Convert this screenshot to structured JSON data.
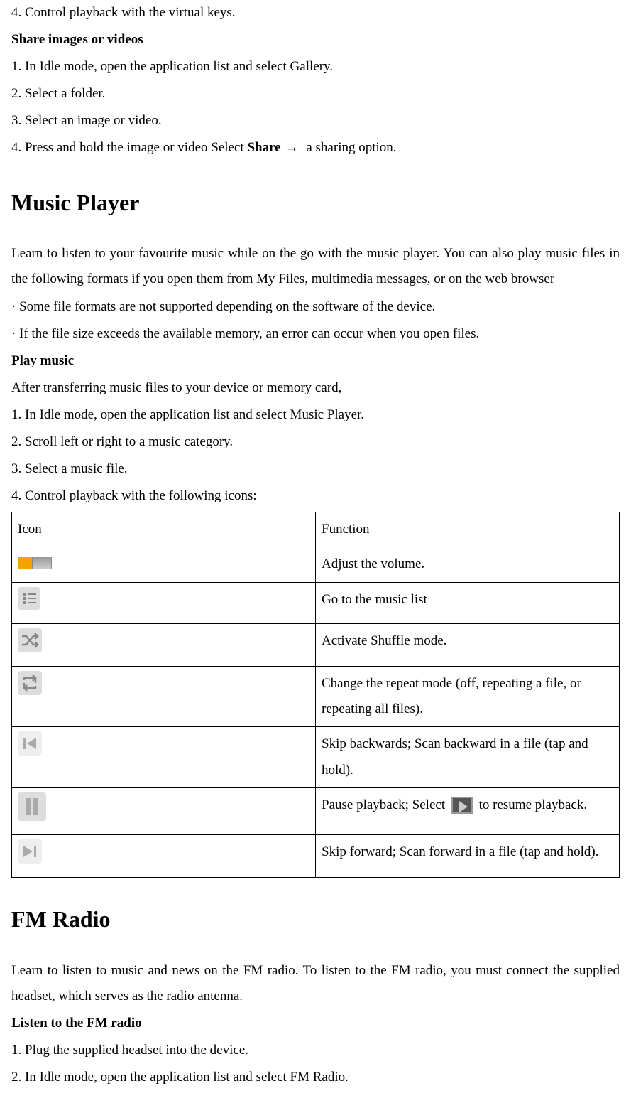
{
  "intro_steps": {
    "s4": "4. Control playback with the virtual keys."
  },
  "share": {
    "heading": "Share images or videos",
    "steps": {
      "s1": "1. In Idle mode, open the application list and select Gallery.",
      "s2": "2. Select a folder.",
      "s3": "3. Select an image or video.",
      "s4_pre": "4. Press and hold the image or video Select ",
      "s4_bold": "Share",
      "s4_post": "  a sharing option."
    }
  },
  "music": {
    "heading": "Music Player",
    "intro": "Learn to listen to your favourite music while on the go with the music player. You can also play music files in the following formats if you open them from My Files, multimedia messages, or on the web browser",
    "bullets": {
      "b1": "· Some file formats are not supported depending on the software of the device.",
      "b2": "· If the file size exceeds the available memory, an error can occur when you open files."
    },
    "play_heading": "Play music",
    "play_intro": "After transferring music files to your device or memory card,",
    "steps": {
      "s1": "1. In Idle mode, open the application list and select Music Player.",
      "s2": "2. Scroll left or right to a music category.",
      "s3": "3. Select a music file.",
      "s4": "4. Control playback with the following icons:"
    },
    "table": {
      "header": {
        "icon": "Icon",
        "function": "Function"
      },
      "rows": {
        "volume": "Adjust the volume.",
        "list": "Go to the music list",
        "shuffle": "Activate Shuffle mode.",
        "repeat": "Change the repeat mode (off, repeating a file, or repeating all files).",
        "prev": "Skip backwards; Scan backward in a file (tap and hold).",
        "pause_pre": "Pause playback; Select",
        "pause_post": " to resume playback.",
        "next": "Skip forward; Scan forward in a file (tap and hold)."
      }
    }
  },
  "fm": {
    "heading": "FM Radio",
    "intro": "Learn to listen to music and news on the FM radio. To listen to the FM radio, you must connect the supplied headset, which serves as the radio antenna.",
    "listen_heading": "Listen to the FM radio",
    "steps": {
      "s1": "1. Plug the supplied headset into the device.",
      "s2": "2. In Idle mode, open the application list and select FM Radio."
    }
  },
  "arrow": "→"
}
